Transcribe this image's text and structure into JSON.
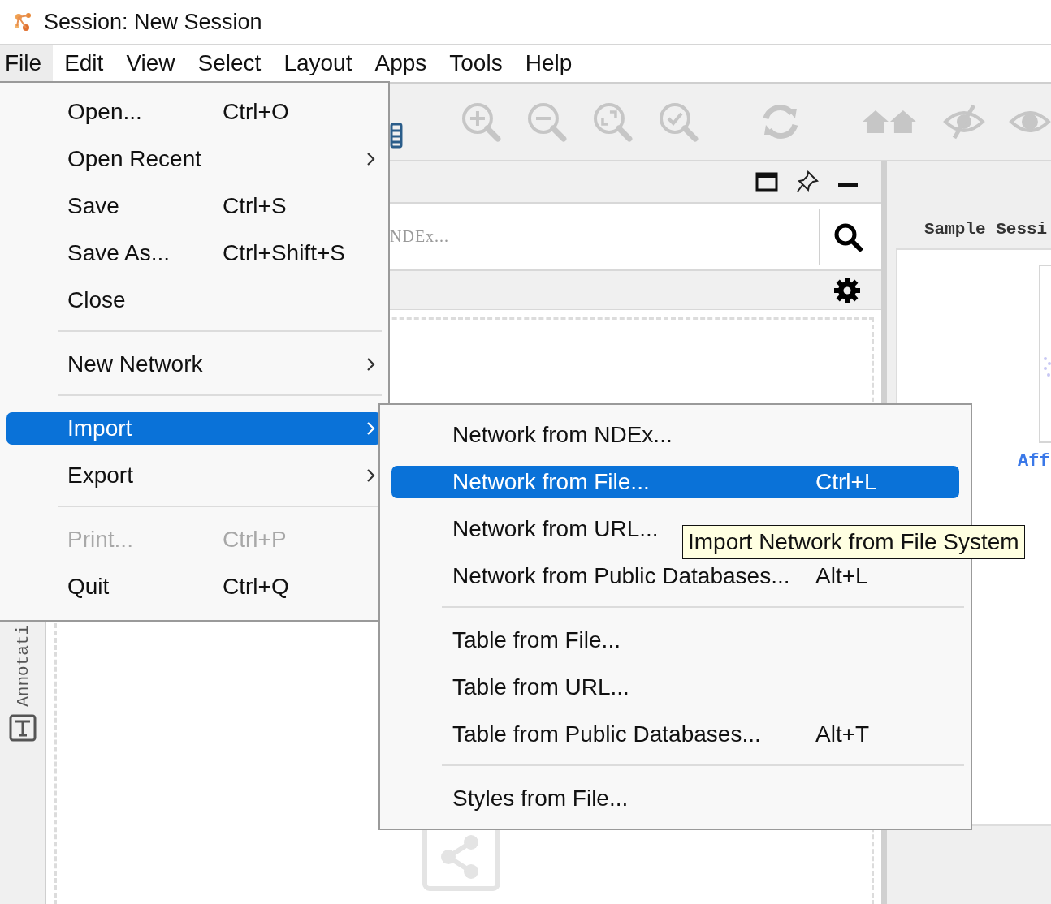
{
  "window": {
    "title": "Session: New Session"
  },
  "menu_bar": [
    {
      "label": "File",
      "selected": true
    },
    {
      "label": "Edit",
      "selected": false
    },
    {
      "label": "View",
      "selected": false
    },
    {
      "label": "Select",
      "selected": false
    },
    {
      "label": "Layout",
      "selected": false
    },
    {
      "label": "Apps",
      "selected": false
    },
    {
      "label": "Tools",
      "selected": false
    },
    {
      "label": "Help",
      "selected": false
    }
  ],
  "network_panel": {
    "search": {
      "placeholder": "NDEx..."
    },
    "side_tab": {
      "label": "Annotati"
    }
  },
  "right_panel": {
    "title": "Sample Sessi",
    "link": "Aff"
  },
  "file_menu": {
    "items": [
      {
        "kind": "item",
        "label": "Open...",
        "shortcut": "Ctrl+O",
        "submenu": false,
        "disabled": false,
        "selected": false
      },
      {
        "kind": "item",
        "label": "Open Recent",
        "submenu": true,
        "disabled": false,
        "selected": false
      },
      {
        "kind": "item",
        "label": "Save",
        "shortcut": "Ctrl+S",
        "submenu": false,
        "disabled": false,
        "selected": false
      },
      {
        "kind": "item",
        "label": "Save As...",
        "shortcut": "Ctrl+Shift+S",
        "submenu": false,
        "disabled": false,
        "selected": false
      },
      {
        "kind": "item",
        "label": "Close",
        "submenu": false,
        "disabled": false,
        "selected": false
      },
      {
        "kind": "separator"
      },
      {
        "kind": "item",
        "label": "New Network",
        "submenu": true,
        "disabled": false,
        "selected": false
      },
      {
        "kind": "separator"
      },
      {
        "kind": "item",
        "label": "Import",
        "submenu": true,
        "disabled": false,
        "selected": true
      },
      {
        "kind": "item",
        "label": "Export",
        "submenu": true,
        "disabled": false,
        "selected": false
      },
      {
        "kind": "separator"
      },
      {
        "kind": "item",
        "label": "Print...",
        "shortcut": "Ctrl+P",
        "submenu": false,
        "disabled": true,
        "selected": false
      },
      {
        "kind": "item",
        "label": "Quit",
        "shortcut": "Ctrl+Q",
        "submenu": false,
        "disabled": false,
        "selected": false
      }
    ]
  },
  "import_submenu": {
    "items": [
      {
        "kind": "item",
        "label": "Network from NDEx...",
        "submenu": false,
        "disabled": false,
        "selected": false
      },
      {
        "kind": "item",
        "label": "Network from File...",
        "shortcut": "Ctrl+L",
        "submenu": false,
        "disabled": false,
        "selected": true
      },
      {
        "kind": "item",
        "label": "Network from URL...",
        "submenu": false,
        "disabled": false,
        "selected": false
      },
      {
        "kind": "item",
        "label": "Network from Public Databases...",
        "shortcut": "Alt+L",
        "submenu": false,
        "disabled": false,
        "selected": false
      },
      {
        "kind": "separator"
      },
      {
        "kind": "item",
        "label": "Table from File...",
        "submenu": false,
        "disabled": false,
        "selected": false
      },
      {
        "kind": "item",
        "label": "Table from URL...",
        "submenu": false,
        "disabled": false,
        "selected": false
      },
      {
        "kind": "item",
        "label": "Table from Public Databases...",
        "shortcut": "Alt+T",
        "submenu": false,
        "disabled": false,
        "selected": false
      },
      {
        "kind": "separator"
      },
      {
        "kind": "item",
        "label": "Styles from File...",
        "submenu": false,
        "disabled": false,
        "selected": false
      }
    ]
  },
  "tooltip": {
    "text": "Import Network from File System"
  }
}
